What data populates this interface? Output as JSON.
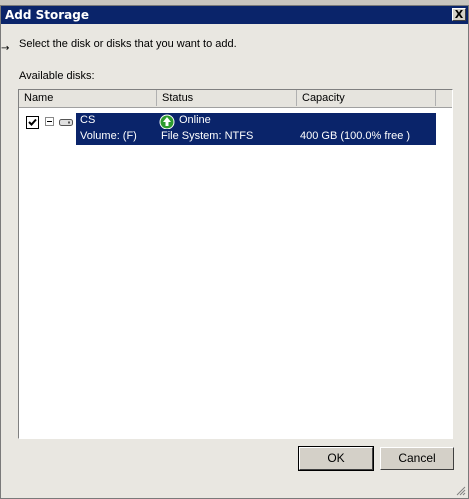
{
  "window": {
    "title": "Add Storage",
    "close_label": "X"
  },
  "instruction": "Select the disk or disks that you want to add.",
  "available_label": "Available disks:",
  "list": {
    "columns": [
      "Name",
      "Status",
      "Capacity"
    ],
    "disk": {
      "checked": true,
      "name": "CS",
      "status": "Online",
      "volume": "Volume: (F)",
      "file_system": "File System: NTFS",
      "capacity": "400 GB (100.0% free )"
    }
  },
  "buttons": {
    "ok": "OK",
    "cancel": "Cancel"
  },
  "colors": {
    "selection": "#0a246a",
    "titlebar": "#0a246a",
    "online_icon": "#2e9c2e"
  },
  "icons": {
    "checkbox": "checkmark-icon",
    "expander": "collapse-minus-icon",
    "disk": "disk-drive-icon",
    "status": "online-up-arrow-icon"
  }
}
